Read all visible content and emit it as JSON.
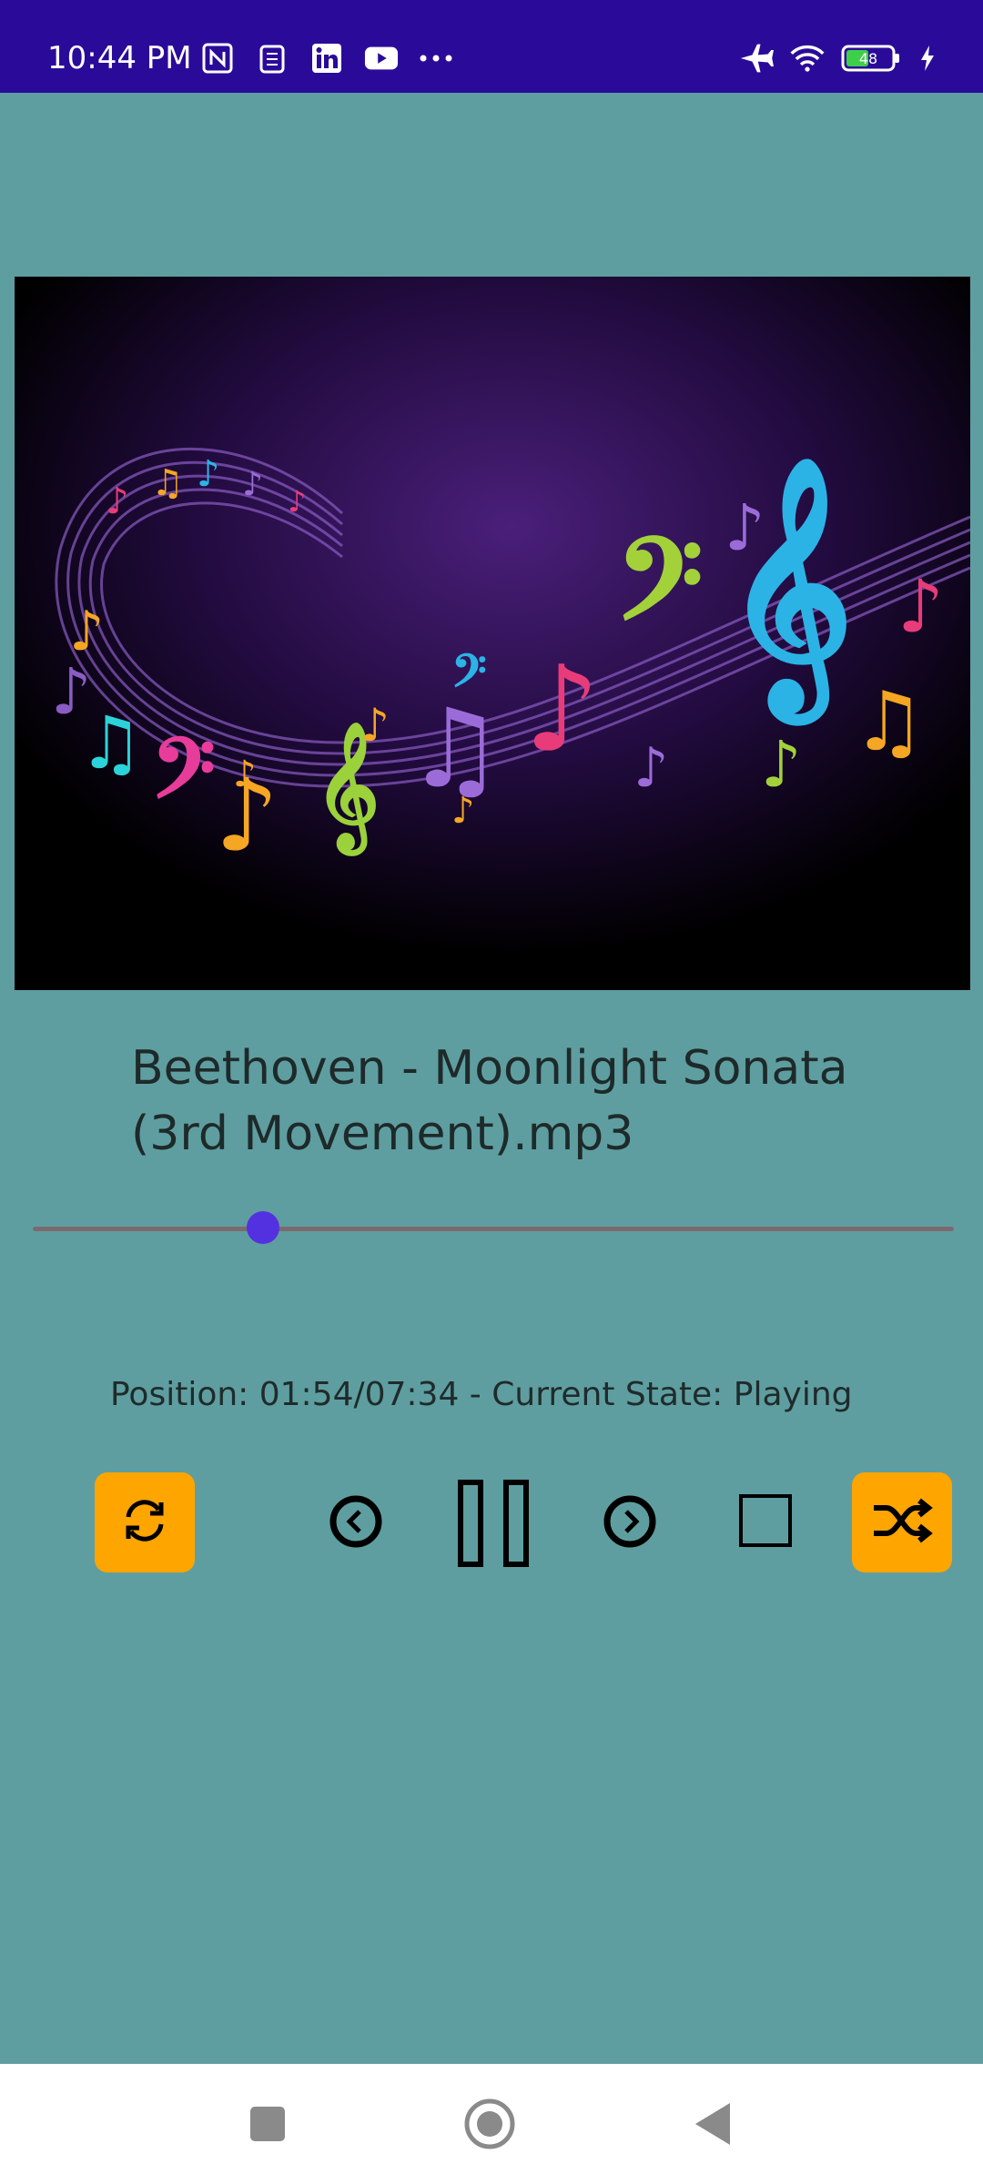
{
  "status_bar": {
    "time": "10:44 PM",
    "battery_level": "48",
    "left_icons": [
      "nfc-icon",
      "sim-icon",
      "linkedin-icon",
      "youtube-icon",
      "more-dots-icon"
    ],
    "right_icons": [
      "airplane-mode-icon",
      "wifi-icon",
      "battery-icon",
      "charging-bolt-icon"
    ],
    "bg_color": "#2a0b99"
  },
  "player": {
    "background_color": "#5f9ea0",
    "album_art": "music-notes-staff-image",
    "song_title": "Beethoven - Moonlight Sonata (3rd Movement).mp3",
    "seek_progress": 0.25,
    "position_text": "Position: 01:54/07:34 - Current State: Playing",
    "accent_color": "#ffa500",
    "thumb_color": "#5431e0"
  },
  "controls": {
    "repeat": "repeat-icon",
    "previous": "previous-icon",
    "pause": "pause-icon",
    "next": "next-icon",
    "stop": "stop-icon",
    "shuffle": "shuffle-icon"
  },
  "nav_bar": {
    "items": [
      "recents-icon",
      "home-icon",
      "back-icon"
    ]
  }
}
